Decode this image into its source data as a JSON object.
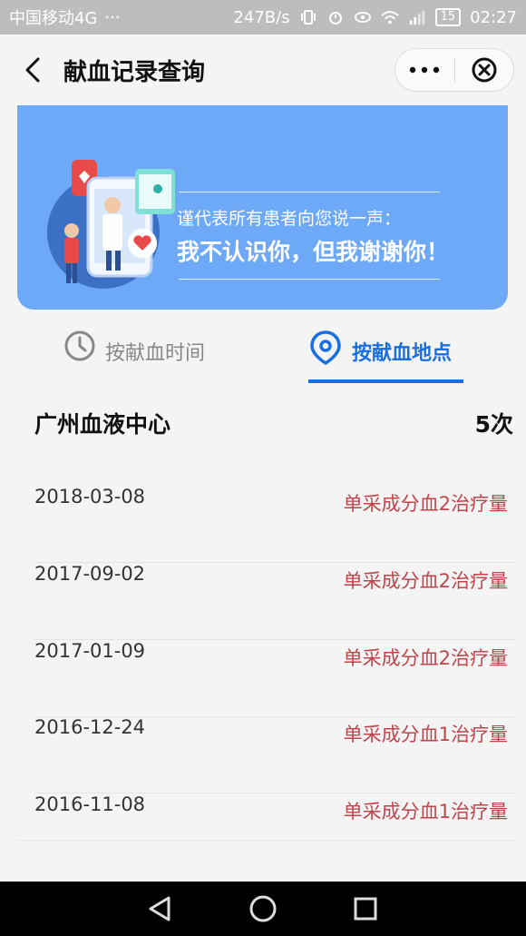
{
  "status_bar": {
    "carrier": "中国移动4G",
    "dots": "···",
    "speed": "247B/s",
    "battery": "15",
    "time": "02:27"
  },
  "nav": {
    "title": "献血记录查询"
  },
  "banner": {
    "subtitle": "谨代表所有患者向您说一声：",
    "headline": "我不认识你，但我谢谢你！"
  },
  "tabs": [
    {
      "label": "按献血时间",
      "icon": "clock-icon",
      "active": false
    },
    {
      "label": "按献血地点",
      "icon": "location-pin-icon",
      "active": true
    }
  ],
  "location": {
    "name": "广州血液中心",
    "count": "5次"
  },
  "records": [
    {
      "date": "2018-03-08",
      "type": "单采成分血2治疗量"
    },
    {
      "date": "2017-09-02",
      "type": "单采成分血2治疗量"
    },
    {
      "date": "2017-01-09",
      "type": "单采成分血2治疗量"
    },
    {
      "date": "2016-12-24",
      "type": "单采成分血1治疗量"
    },
    {
      "date": "2016-11-08",
      "type": "单采成分血1治疗量"
    }
  ],
  "colors": {
    "accent": "#1a6fe0",
    "banner": "#6ea9f7",
    "record_type": "#c0454b"
  }
}
